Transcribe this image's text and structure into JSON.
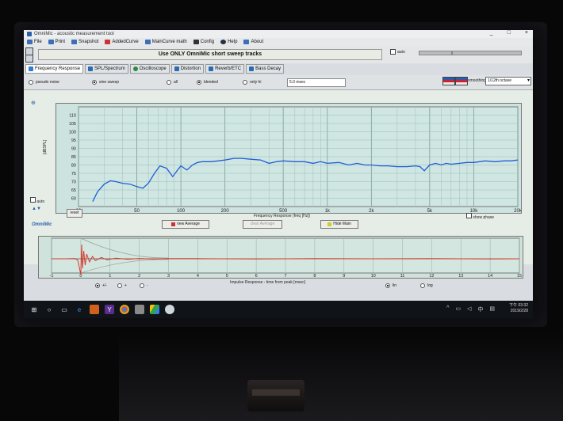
{
  "window": {
    "title": "OmniMic - acoustic measurement tool",
    "controls": [
      "_",
      "□",
      "×"
    ]
  },
  "menu": [
    {
      "id": "file",
      "label": "File"
    },
    {
      "id": "print",
      "label": "Print"
    },
    {
      "id": "snapshot",
      "label": "Snapshot"
    },
    {
      "id": "addedcurve",
      "label": "AddedCurve"
    },
    {
      "id": "maincurve",
      "label": "MainCurve math"
    },
    {
      "id": "config",
      "label": "Config"
    },
    {
      "id": "help",
      "label": "Help"
    },
    {
      "id": "about",
      "label": "About"
    }
  ],
  "notice": "Use ONLY OmniMic short sweep tracks",
  "auto_label": "auto",
  "tabs": [
    {
      "label": "Frequency Response",
      "color": "#2f7dd1",
      "active": true
    },
    {
      "label": "SPL/Spectrum",
      "color": "#2b6bb0",
      "active": false
    },
    {
      "label": "Oscilloscope",
      "color": "#2d8a3e",
      "active": false
    },
    {
      "label": "Distortion",
      "color": "#2b6bb0",
      "active": false
    },
    {
      "label": "Reverb/ETC",
      "color": "#2b6bb0",
      "active": false
    },
    {
      "label": "Bass Decay",
      "color": "#2b6bb0",
      "active": false
    }
  ],
  "options": {
    "signal": [
      {
        "label": "pseudo noise",
        "selected": false
      },
      {
        "label": "sine sweep",
        "selected": true
      }
    ],
    "gating": [
      {
        "label": "all",
        "selected": false
      },
      {
        "label": "blended",
        "selected": true
      },
      {
        "label": "only hi",
        "selected": false
      }
    ],
    "gate_value": "5.0 msec",
    "smoothing_label": "smoothing",
    "smoothing_value": "1/12th octave"
  },
  "fr_plot": {
    "ylabel": "[dBSPL]",
    "auto_label": "auto",
    "brand": "OmniMic",
    "xlabel": "Frequency Response (freq [Hz])",
    "show_phase": "show phase",
    "reset": "reset",
    "buttons": {
      "new_average": "new Average",
      "clear_average": "clear Average",
      "hide_main": "Hide Main"
    },
    "line_color": "#1f5fd6"
  },
  "ir_plot": {
    "xlabel": "Impulse Response  -  time from peak [msec]",
    "polarity": [
      {
        "label": "+/-",
        "selected": true
      },
      {
        "label": "+",
        "selected": false
      },
      {
        "label": "-",
        "selected": false
      }
    ],
    "scale": [
      {
        "label": "lin",
        "selected": true
      },
      {
        "label": "log",
        "selected": false
      }
    ],
    "line_color": "#d83a2c"
  },
  "chart_data": [
    {
      "type": "line",
      "title": "",
      "xlabel": "Frequency Response (freq [Hz])",
      "ylabel": "[dBSPL]",
      "x_scale": "log",
      "xlim": [
        20,
        20000
      ],
      "ylim": [
        55,
        115
      ],
      "yticks": [
        60,
        65,
        70,
        75,
        80,
        85,
        90,
        95,
        100,
        105,
        110
      ],
      "xticks": [
        {
          "v": 20,
          "l": "20"
        },
        {
          "v": 50,
          "l": "50"
        },
        {
          "v": 100,
          "l": "100"
        },
        {
          "v": 200,
          "l": "200"
        },
        {
          "v": 500,
          "l": "500"
        },
        {
          "v": 1000,
          "l": "1k"
        },
        {
          "v": 2000,
          "l": "2k"
        },
        {
          "v": 5000,
          "l": "5k"
        },
        {
          "v": 10000,
          "l": "10k"
        },
        {
          "v": 20000,
          "l": "20k"
        }
      ],
      "grid": true,
      "series": [
        {
          "x": [
            25,
            27,
            30,
            33,
            36,
            40,
            45,
            50,
            55,
            60,
            66,
            72,
            80,
            88,
            95,
            100,
            110,
            120,
            130,
            140,
            160,
            180,
            200,
            230,
            260,
            300,
            350,
            400,
            450,
            500,
            600,
            700,
            800,
            900,
            1000,
            1200,
            1400,
            1600,
            1800,
            2000,
            2300,
            2600,
            3000,
            3500,
            4000,
            4300,
            4600,
            5000,
            5500,
            6000,
            6500,
            7000,
            8000,
            9000,
            10000,
            12000,
            14000,
            16000,
            18000,
            20000
          ],
          "y": [
            58,
            64,
            68.5,
            70.5,
            70,
            69,
            68.5,
            67,
            66,
            69,
            75,
            79.5,
            78,
            73,
            77,
            79.5,
            77,
            80,
            81.5,
            82,
            82,
            82.5,
            83,
            84,
            84,
            83.5,
            83,
            81,
            82,
            82.5,
            82,
            82,
            81,
            82,
            81,
            81.5,
            80,
            81,
            80,
            80,
            79.5,
            79.5,
            79,
            79,
            79.5,
            79,
            76.5,
            80,
            81,
            80,
            81,
            80.5,
            81,
            81.5,
            81.5,
            82.5,
            82,
            82.5,
            82.5,
            83
          ]
        }
      ]
    },
    {
      "type": "line",
      "title": "",
      "xlabel": "Impulse Response  -  time from peak [msec]",
      "ylabel": "",
      "xlim": [
        -1,
        15
      ],
      "xticks": [
        -1,
        0,
        1,
        2,
        3,
        4,
        5,
        6,
        7,
        8,
        9,
        10,
        11,
        12,
        13,
        14,
        15
      ],
      "grid": true,
      "series": [
        {
          "x": [
            -1,
            -0.5,
            -0.2,
            -0.1,
            0,
            0.03,
            0.06,
            0.1,
            0.15,
            0.2,
            0.3,
            0.4,
            0.5,
            0.7,
            0.9,
            1.2,
            1.6,
            2,
            2.5,
            3,
            4,
            6,
            8,
            10,
            12,
            14,
            15
          ],
          "y": [
            0,
            0,
            0.02,
            -0.1,
            -1,
            0.9,
            -0.6,
            0.5,
            -0.4,
            0.3,
            -0.2,
            0.15,
            -0.12,
            0.08,
            -0.06,
            0.04,
            -0.03,
            0.02,
            -0.02,
            0.01,
            0.01,
            -0.01,
            0.01,
            0,
            0.01,
            -0.01,
            0
          ]
        }
      ]
    }
  ],
  "taskbar": {
    "icons": [
      "windows-start",
      "search",
      "task-view",
      "edge",
      "office",
      "yahoo",
      "chrome",
      "app",
      "drive",
      "media"
    ],
    "time": "下午 03:32",
    "date": "2019/2/28"
  }
}
